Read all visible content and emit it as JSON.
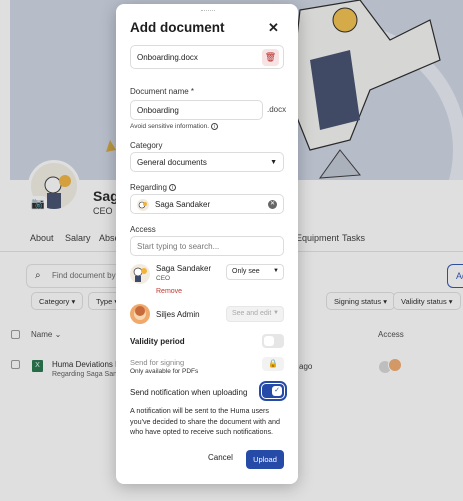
{
  "background": {
    "profile_name": "Saga",
    "profile_role": "CEO",
    "tabs": [
      "About",
      "Salary",
      "Abse",
      "Equipment",
      "Tasks"
    ],
    "search_placeholder": "Find document by t",
    "add_label": "Ad",
    "filters": [
      "Category",
      "Type",
      "Signing status",
      "Validity status"
    ],
    "table_headers": {
      "name": "Name",
      "access": "Access"
    },
    "row": {
      "title": "Huma Deviations Ex",
      "subtitle": "Regarding Saga Sandak",
      "date": "ago"
    }
  },
  "modal": {
    "title": "Add document",
    "file_name": "Onboarding.docx",
    "document_name_label": "Document name *",
    "document_name_value": "Onboarding",
    "extension": ".docx",
    "hint": "Avoid sensitive information.",
    "category_label": "Category",
    "category_value": "General documents",
    "regarding_label": "Regarding",
    "regarding_value": "Saga Sandaker",
    "access_label": "Access",
    "access_placeholder": "Start typing to search...",
    "people": [
      {
        "name": "Saga Sandaker",
        "role": "CEO",
        "permission": "Only see",
        "remove": "Remove"
      },
      {
        "name": "Siljes Admin",
        "permission": "See and edit"
      }
    ],
    "validity_label": "Validity period",
    "signing_label": "Send for signing",
    "signing_sub": "Only available for PDFs",
    "notification_label": "Send notification when uploading",
    "notice": "A notification will be sent to the Huma users you've decided to share the document with and who have opted to receive such notifications.",
    "cancel": "Cancel",
    "upload": "Upload"
  }
}
